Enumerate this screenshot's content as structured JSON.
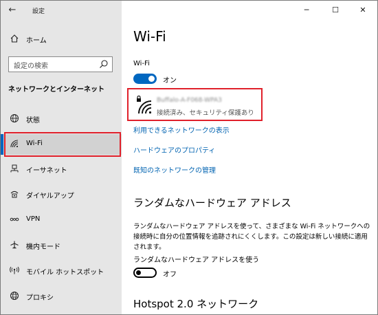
{
  "window": {
    "app_title": "設定",
    "back_icon": "back-arrow-icon",
    "controls": {
      "minimize": "─",
      "maximize": "☐",
      "close": "✕"
    }
  },
  "sidebar": {
    "home_label": "ホーム",
    "search_placeholder": "設定の検索",
    "section_title": "ネットワークとインターネット",
    "items": [
      {
        "label": "状態",
        "icon": "globe-icon"
      },
      {
        "label": "Wi-Fi",
        "icon": "wifi-icon",
        "selected": true
      },
      {
        "label": "イーサネット",
        "icon": "ethernet-icon"
      },
      {
        "label": "ダイヤルアップ",
        "icon": "dialup-icon"
      },
      {
        "label": "VPN",
        "icon": "vpn-icon"
      },
      {
        "label": "機内モード",
        "icon": "airplane-icon"
      },
      {
        "label": "モバイル ホットスポット",
        "icon": "hotspot-icon"
      },
      {
        "label": "プロキシ",
        "icon": "proxy-globe-icon"
      }
    ]
  },
  "main": {
    "title": "Wi-Fi",
    "wifi_label": "Wi-Fi",
    "wifi_toggle_text": "オン",
    "wifi_on": true,
    "network": {
      "name": "Buffalo-A-F068-WPA3",
      "status": "接続済み、セキュリティ保護あり"
    },
    "links": {
      "available": "利用できるネットワークの表示",
      "hardware": "ハードウェアのプロパティ",
      "known": "既知のネットワークの管理"
    },
    "random_hw": {
      "heading": "ランダムなハードウェア アドレス",
      "description": "ランダムなハードウェア アドレスを使って、さまざまな Wi-Fi ネットワークへの接続時に自分の位置情報を追跡されにくくします。この設定は新しい接続に適用されます。",
      "toggle_label": "ランダムなハードウェア アドレスを使う",
      "toggle_text": "オフ",
      "on": false
    },
    "hotspot_heading": "Hotspot 2.0 ネットワーク"
  },
  "colors": {
    "accent": "#0067c0",
    "link": "#0063b1",
    "highlight": "#e0202a",
    "sidebar_bg": "#e6e6e6"
  }
}
